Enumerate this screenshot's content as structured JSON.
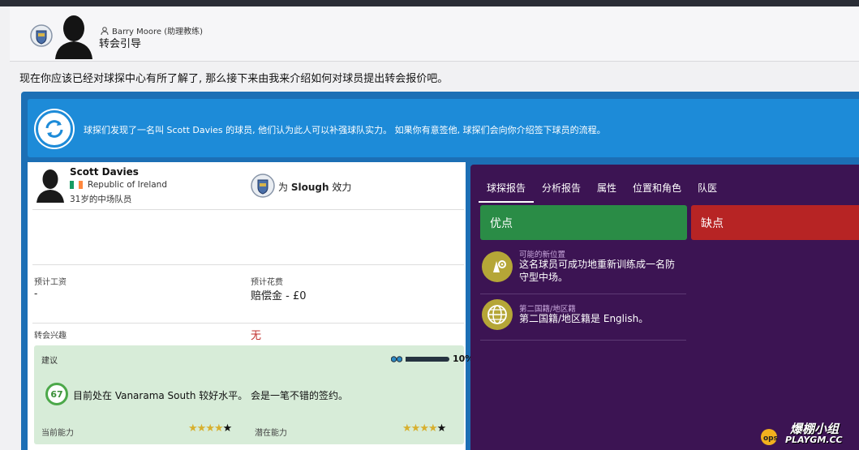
{
  "header": {
    "speaker_name": "Barry Moore (助理教练)",
    "title": "转会引导"
  },
  "intro_text": "现在你应该已经对球探中心有所了解了, 那么接下来由我来介绍如何对球员提出转会报价吧。",
  "banner": {
    "text": "球探们发现了一名叫 Scott Davies 的球员, 他们认为此人可以补强球队实力。 如果你有意签他, 球探们会向你介绍签下球员的流程。",
    "icon": "refresh-cycle-icon"
  },
  "player": {
    "name": "Scott Davies",
    "nation": "Republic of Ireland",
    "nation_flag_colors": [
      "#169b62",
      "#ffffff",
      "#ff883e"
    ],
    "age_position": "31岁的中场队员",
    "plays_for_prefix": "为",
    "club": "Slough",
    "plays_for_suffix": "效力"
  },
  "details": {
    "wage_label": "预计工资",
    "wage_value": "-",
    "fee_label": "预计花费",
    "fee_value": "赔偿金 - £0",
    "interest_label": "转会兴趣",
    "interest_value": "无"
  },
  "advice": {
    "label": "建议",
    "confidence_pct": "10%",
    "confidence_fraction": 0.1,
    "ability_score": "67",
    "text": "目前处在 Vanarama South 较好水平。 会是一笔不错的签约。",
    "current_ability_label": "当前能力",
    "current_ability_stars": 3.5,
    "potential_ability_label": "潜在能力",
    "potential_ability_stars": 4
  },
  "tabs": [
    {
      "label": "球探报告",
      "active": true
    },
    {
      "label": "分析报告",
      "active": false
    },
    {
      "label": "属性",
      "active": false
    },
    {
      "label": "位置和角色",
      "active": false
    },
    {
      "label": "队医",
      "active": false
    }
  ],
  "report": {
    "pros_title": "优点",
    "cons_title": "缺点",
    "pros": [
      {
        "category": "可能的新位置",
        "text_line1": "这名球员可成功地重新训练成一名防",
        "text_line2": "守型中场。",
        "icon": "position-change-icon"
      },
      {
        "category": "第二国籍/地区籍",
        "text_line1": "第二国籍/地区籍是 English。",
        "text_line2": "",
        "icon": "globe-icon"
      }
    ]
  },
  "watermark": {
    "line1": "爆棚小组",
    "line2": "PLAYGM.CC"
  },
  "colors": {
    "banner_blue": "#1d8bd8",
    "pros_green": "#2a8c46",
    "cons_red": "#b72424",
    "panel_purple": "#3c1453",
    "advice_green": "#d7ecd8"
  }
}
